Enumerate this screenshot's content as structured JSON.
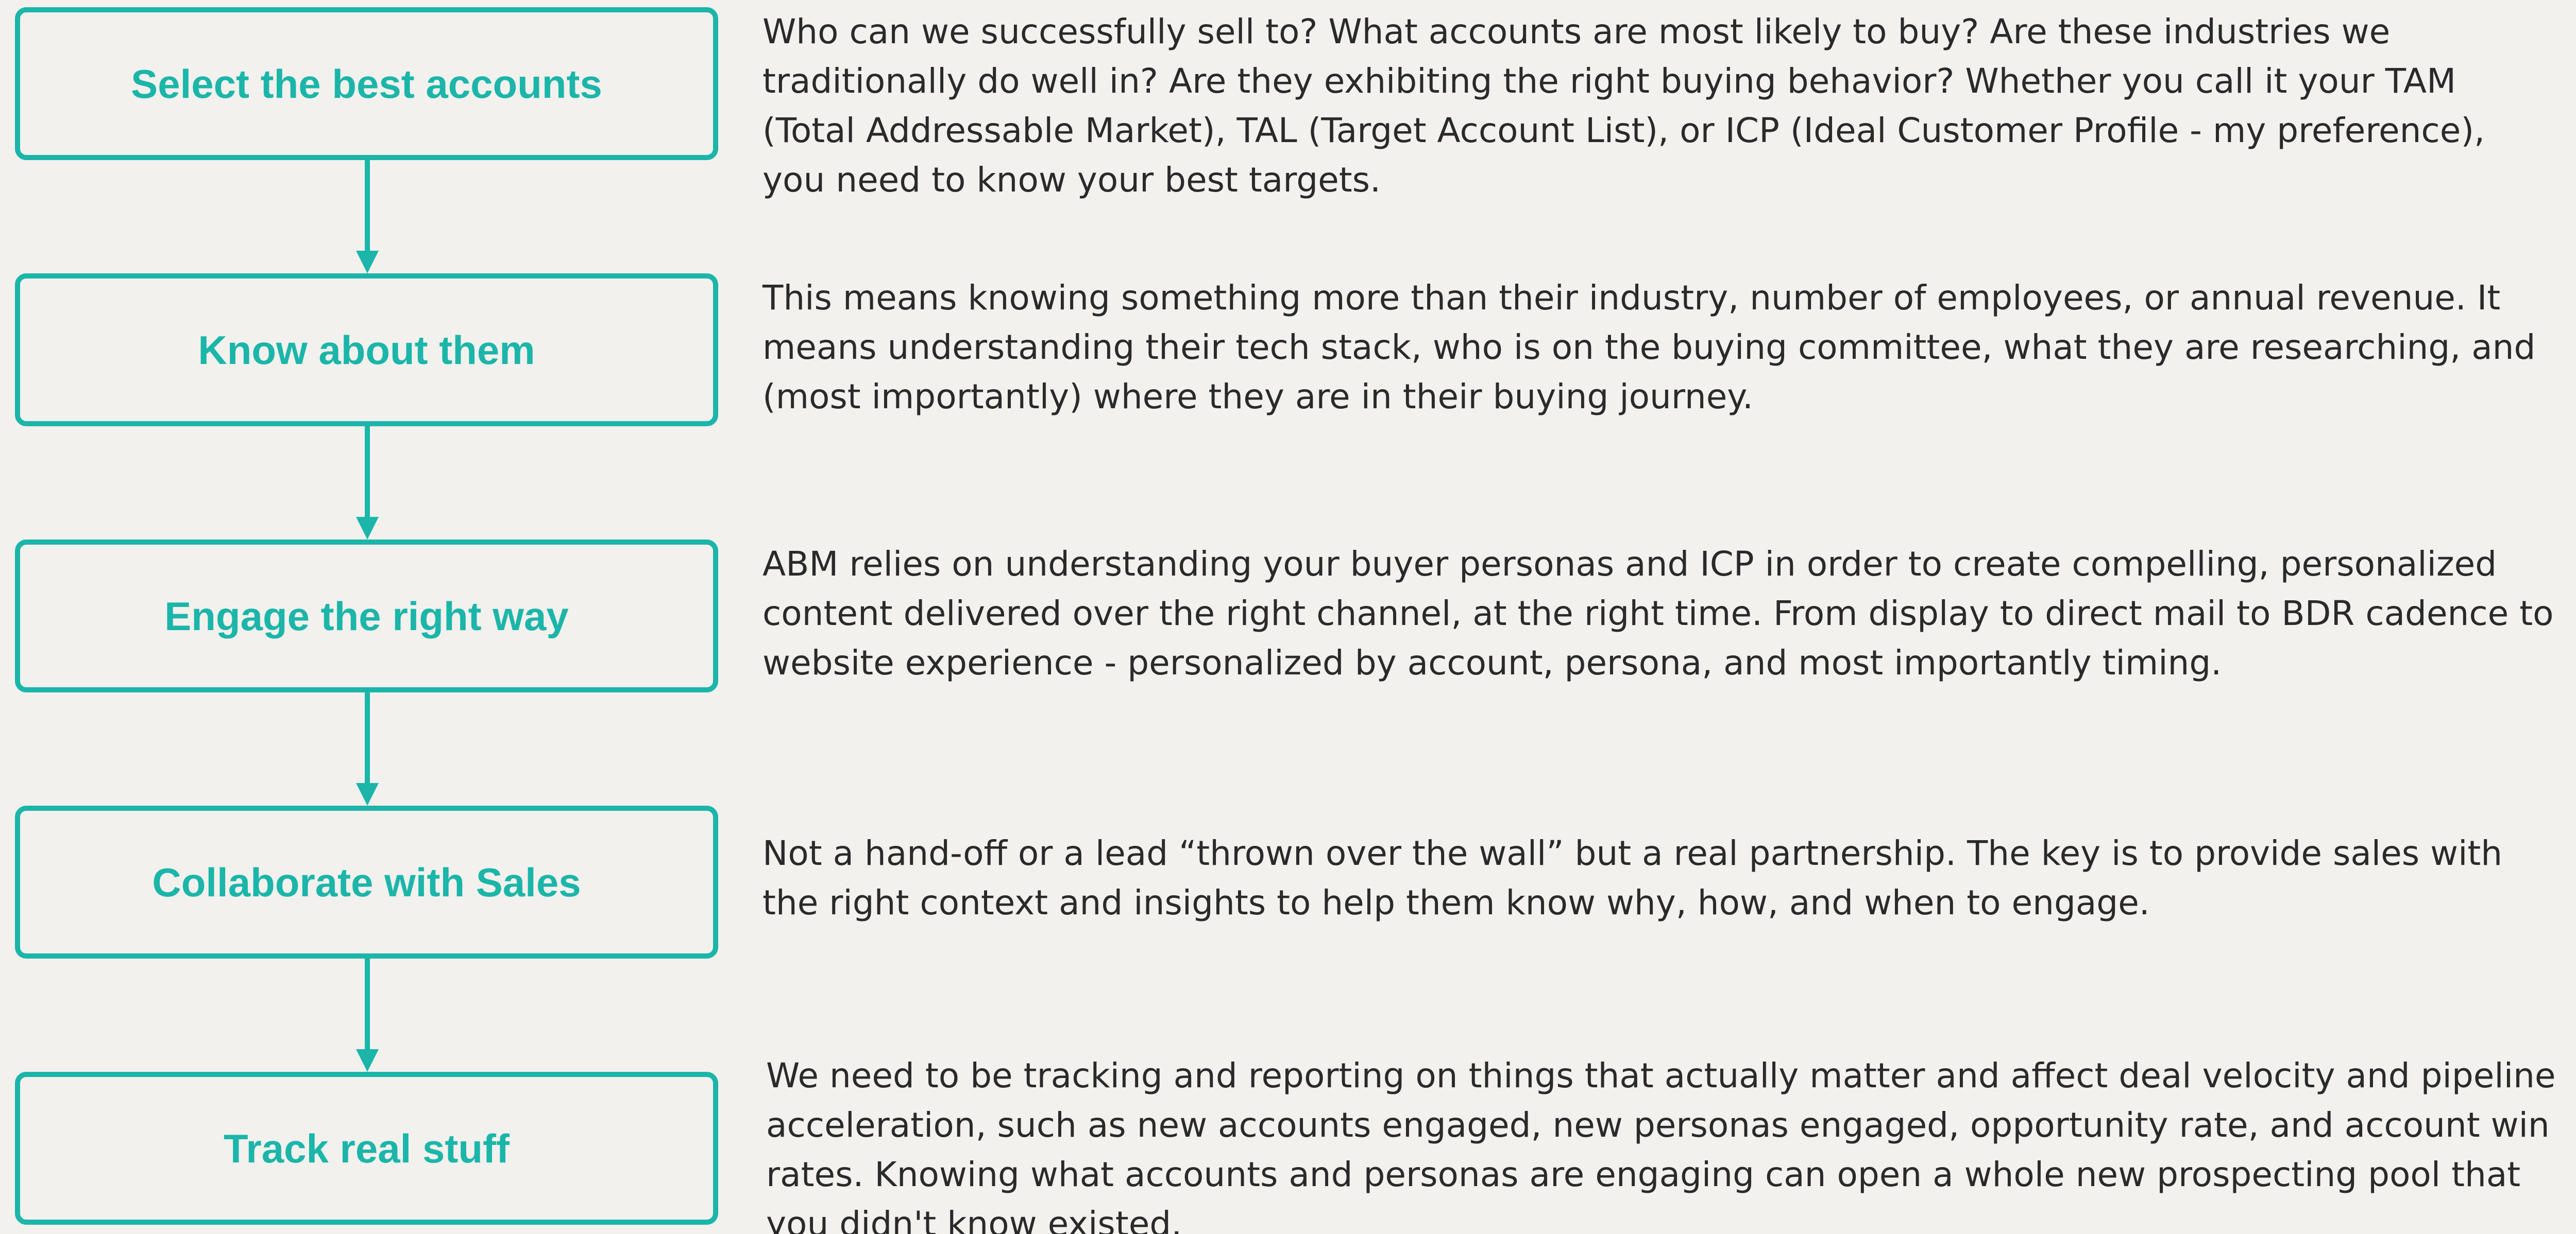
{
  "colors": {
    "background": "#F3F1EE",
    "accent": "#1BB5AA",
    "text": "#2A2A2A"
  },
  "steps": [
    {
      "title": "Select the best accounts",
      "description": "Who can we successfully sell to? What accounts are most likely to buy? Are these industries we traditionally do well in? Are they exhibiting the right buying behavior? Whether you call it your TAM (Total Addressable Market), TAL (Target Account List), or ICP (Ideal Customer Profile - my preference), you need to know your best targets."
    },
    {
      "title": "Know about them",
      "description": "This means knowing something more than their industry, number of employees, or annual revenue. It means understanding their tech stack, who is on the buying committee, what they are researching, and (most importantly) where they are in their buying journey."
    },
    {
      "title": "Engage the right way",
      "description": "ABM relies on understanding your buyer personas and ICP in order to create compelling, personalized content delivered over the right channel, at the right time. From display to direct mail to BDR cadence to website experience - personalized by account, persona, and most importantly timing."
    },
    {
      "title": "Collaborate with Sales",
      "description": "Not a hand-off or a lead “thrown over the wall” but a real partnership. The key is to provide sales with the right context and insights to help them know why, how, and when to engage."
    },
    {
      "title": "Track real stuff",
      "description": "We need to be tracking and reporting on things that actually matter and affect deal velocity and pipeline acceleration, such as new accounts engaged, new personas engaged, opportunity rate, and account win rates. Knowing what accounts and personas are engaging can open a whole new prospecting pool that you didn't know existed."
    }
  ]
}
